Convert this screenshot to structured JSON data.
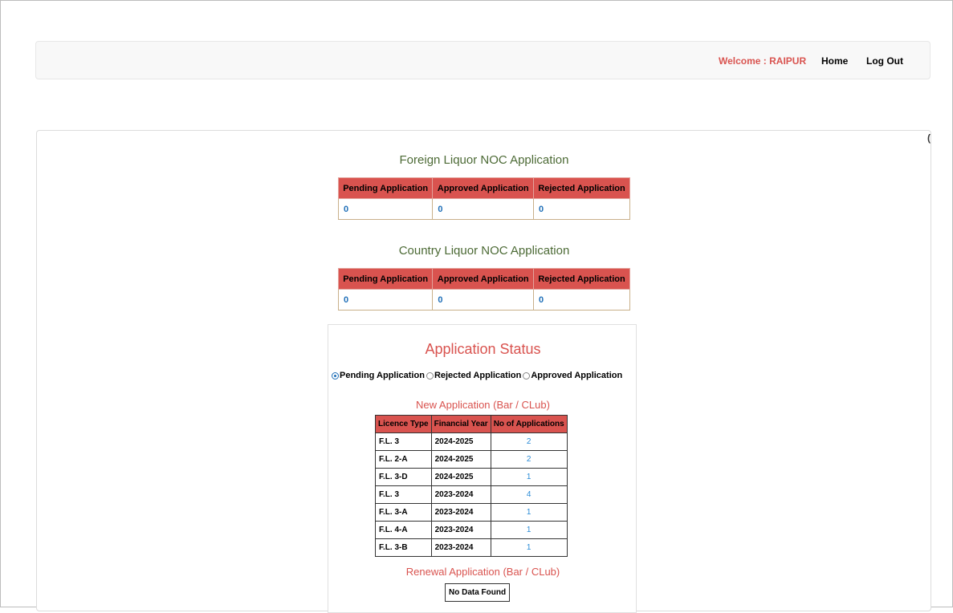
{
  "navbar": {
    "welcome": "Welcome : RAIPUR",
    "home": "Home",
    "logout": "Log Out"
  },
  "edge_glyph": "(",
  "foreign_noc": {
    "title": "Foreign Liquor NOC Application",
    "headers": [
      "Pending Application",
      "Approved Application",
      "Rejected Application"
    ],
    "values": [
      "0",
      "0",
      "0"
    ]
  },
  "country_noc": {
    "title": "Country Liquor NOC Application",
    "headers": [
      "Pending Application",
      "Approved Application",
      "Rejected Application"
    ],
    "values": [
      "0",
      "0",
      "0"
    ]
  },
  "application_status": {
    "title": "Application Status",
    "radios": [
      {
        "label": "Pending Application",
        "checked": true
      },
      {
        "label": "Rejected Application",
        "checked": false
      },
      {
        "label": "Approved Application",
        "checked": false
      }
    ],
    "new_application": {
      "title": "New Application (Bar / CLub)",
      "headers": [
        "Licence Type",
        "Financial Year",
        "No of Applications"
      ],
      "rows": [
        [
          "F.L. 3",
          "2024-2025",
          "2"
        ],
        [
          "F.L. 2-A",
          "2024-2025",
          "2"
        ],
        [
          "F.L. 3-D",
          "2024-2025",
          "1"
        ],
        [
          "F.L. 3",
          "2023-2024",
          "4"
        ],
        [
          "F.L. 3-A",
          "2023-2024",
          "1"
        ],
        [
          "F.L. 4-A",
          "2023-2024",
          "1"
        ],
        [
          "F.L. 3-B",
          "2023-2024",
          "1"
        ]
      ]
    },
    "renewal_application": {
      "title": "Renewal Application (Bar / CLub)",
      "no_data": "No Data Found"
    }
  }
}
